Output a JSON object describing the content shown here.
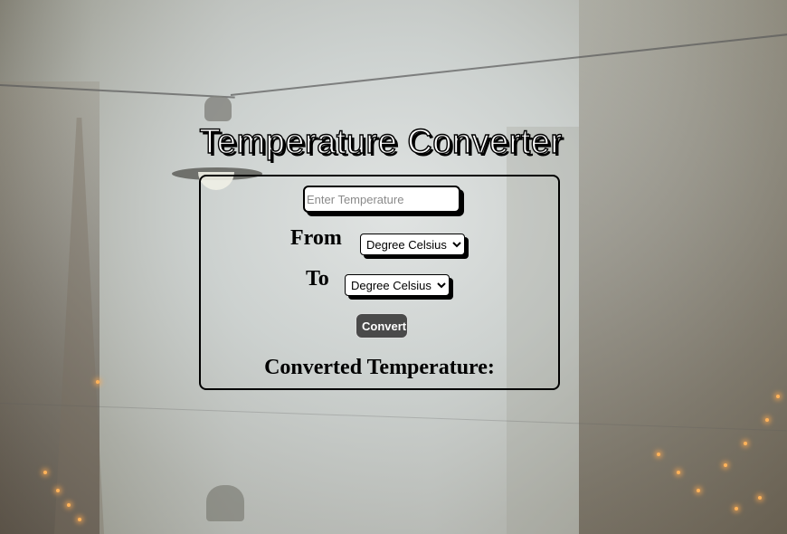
{
  "page": {
    "title": "Temperature Converter"
  },
  "converter": {
    "input_placeholder": "Enter Temperature",
    "input_value": "",
    "from_label": "From",
    "from_selected": "Degree Celsius",
    "to_label": "To",
    "to_selected": "Degree Celsius",
    "convert_label": "Convert",
    "result_label": "Converted Temperature:"
  },
  "colors": {
    "title_fill": "#ffffff",
    "outline": "#000000",
    "button_bg": "#4a4a4a",
    "button_text": "#ffffff"
  }
}
